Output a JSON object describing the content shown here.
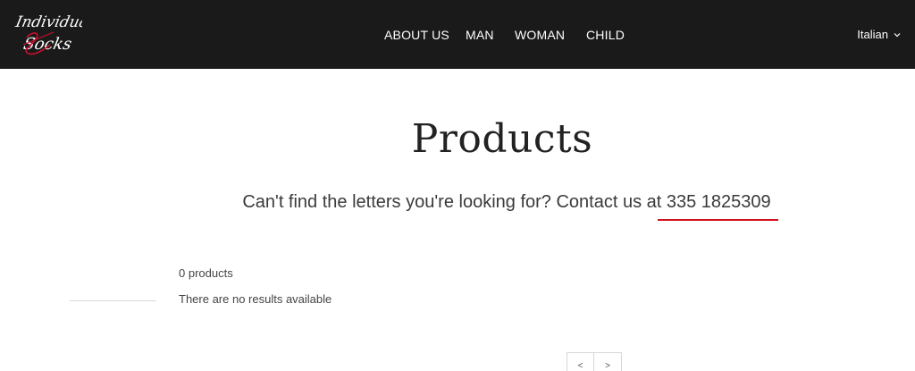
{
  "header": {
    "logo_text": "Individual Socks",
    "nav": [
      {
        "label": "ABOUT US"
      },
      {
        "label": "MAN"
      },
      {
        "label": "WOMAN"
      },
      {
        "label": "CHILD"
      }
    ],
    "language": {
      "label": "Italian",
      "icon": "chevron-down-icon"
    },
    "colors": {
      "background": "#1b1a1a",
      "text": "#ffffff",
      "logo_accent": "#c8102e"
    }
  },
  "main": {
    "title": "Products",
    "contact_text": "Can't find the letters you're looking for? Contact us at ",
    "contact_phone": "335 1825309",
    "accent_color": "#d0101c",
    "results_count": "0 products",
    "no_results": "There are no results available"
  },
  "pagination": {
    "prev_label": "<",
    "next_label": ">"
  }
}
